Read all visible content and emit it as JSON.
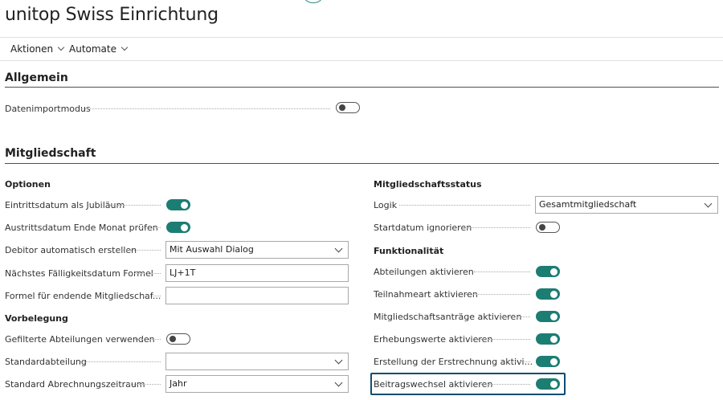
{
  "page": {
    "title": "unitop Swiss Einrichtung"
  },
  "actions": [
    {
      "label": "Aktionen"
    },
    {
      "label": "Automate"
    }
  ],
  "allgemein": {
    "title": "Allgemein",
    "fields": [
      {
        "label": "Datenimportmodus",
        "type": "toggle",
        "value": false
      }
    ]
  },
  "mitgliedschaft": {
    "title": "Mitgliedschaft",
    "optionen": {
      "title": "Optionen",
      "fields": [
        {
          "label": "Eintrittsdatum als Jubiläum",
          "type": "toggle",
          "value": true
        },
        {
          "label": "Austrittsdatum Ende Monat prüfen",
          "type": "toggle",
          "value": true
        },
        {
          "label": "Debitor automatisch erstellen",
          "type": "select",
          "value": "Mit Auswahl Dialog"
        },
        {
          "label": "Nächstes Fälligkeitsdatum Formel",
          "type": "input",
          "value": "LJ+1T"
        },
        {
          "label": "Formel für endende Mitgliedschaf...",
          "type": "input",
          "value": ""
        }
      ]
    },
    "vorbelegung": {
      "title": "Vorbelegung",
      "fields": [
        {
          "label": "Gefilterte Abteilungen verwenden",
          "type": "toggle",
          "value": false
        },
        {
          "label": "Standardabteilung",
          "type": "select",
          "value": ""
        },
        {
          "label": "Standard Abrechnungszeitraum",
          "type": "select",
          "value": "Jahr"
        }
      ]
    },
    "status": {
      "title": "Mitgliedschaftsstatus",
      "fields": [
        {
          "label": "Logik",
          "type": "select",
          "value": "Gesamtmitgliedschaft"
        },
        {
          "label": "Startdatum ignorieren",
          "type": "toggle",
          "value": false
        }
      ]
    },
    "funktionalitaet": {
      "title": "Funktionalität",
      "fields": [
        {
          "label": "Abteilungen aktivieren",
          "type": "toggle",
          "value": true
        },
        {
          "label": "Teilnahmeart aktivieren",
          "type": "toggle",
          "value": true
        },
        {
          "label": "Mitgliedschaftsanträge aktivieren",
          "type": "toggle",
          "value": true
        },
        {
          "label": "Erhebungswerte aktivieren",
          "type": "toggle",
          "value": true
        },
        {
          "label": "Erstellung der Erstrechnung aktivi...",
          "type": "toggle",
          "value": true
        },
        {
          "label": "Beitragswechsel aktivieren",
          "type": "toggle",
          "value": true
        }
      ]
    }
  },
  "colors": {
    "accent": "#1c7d73",
    "focus": "#0f4c75"
  }
}
